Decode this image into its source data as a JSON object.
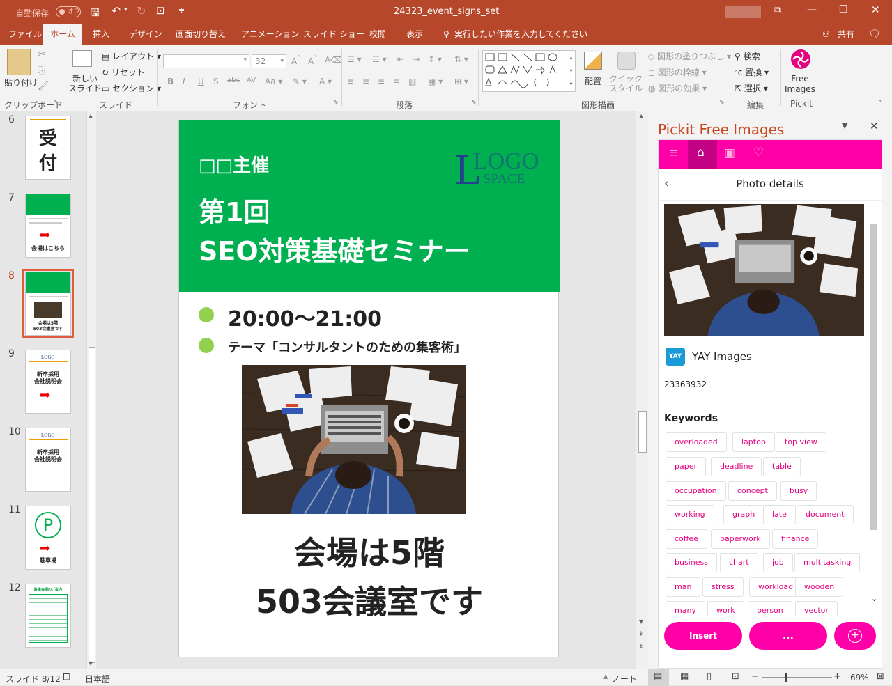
{
  "app": {
    "autosave_label": "自動保存",
    "autosave_state": "オフ",
    "filename": "24323_event_signs_set",
    "accent": "#b7472a"
  },
  "tabs": [
    "ファイル",
    "ホーム",
    "挿入",
    "デザイン",
    "画面切り替え",
    "アニメーション",
    "スライド ショー",
    "校閲",
    "表示"
  ],
  "active_tab": "ホーム",
  "tell_me": "実行したい作業を入力してください",
  "share_label": "共有",
  "ribbon": {
    "clipboard": {
      "paste": "貼り付け",
      "group": "クリップボード"
    },
    "slides": {
      "new_slide": "新しい\nスライド",
      "layout": "レイアウト",
      "reset": "リセット",
      "section": "セクション",
      "group": "スライド"
    },
    "font": {
      "font_size": "32",
      "group": "フォント"
    },
    "paragraph": {
      "group": "段落"
    },
    "drawing": {
      "arrange": "配置",
      "quick_styles": "クイック\nスタイル",
      "fill": "図形の塗りつぶし",
      "outline": "図形の枠線",
      "effects": "図形の効果",
      "group": "図形描画"
    },
    "editing": {
      "find": "検索",
      "replace": "置換",
      "select": "選択",
      "group": "編集"
    },
    "pickit": {
      "button": "Free\nImages",
      "group": "Pickit"
    }
  },
  "thumbnails": [
    {
      "num": "6",
      "text": "受\n付"
    },
    {
      "num": "7",
      "text": "会場はこちら"
    },
    {
      "num": "8",
      "text": "会場は5階\n503会議室です"
    },
    {
      "num": "9",
      "text": "新卒採用\n会社説明会"
    },
    {
      "num": "10",
      "text": "新卒採用\n会社説明会"
    },
    {
      "num": "11",
      "text": "駐車場"
    },
    {
      "num": "12",
      "text": "駐車会場のご案内"
    }
  ],
  "selected_thumbnail": "8",
  "slide": {
    "organizer": "□□主催",
    "logo_top": "LOGO",
    "logo_bottom": "SPACE",
    "title_line1": "第1回",
    "title_line2": "SEO対策基礎セミナー",
    "time": "20:00～21:00",
    "theme": "テーマ「コンサルタントのための集客術」",
    "venue_line1": "会場は5階",
    "venue_line2": "503会議室です",
    "header_color": "#00b050",
    "bullet_color": "#92d050"
  },
  "pickit": {
    "pane_title": "Pickit Free Images",
    "detail_title": "Photo details",
    "source": "YAY Images",
    "source_icon_text": "YAY",
    "image_id": "23363932",
    "keywords_label": "Keywords",
    "keywords": [
      "overloaded",
      "laptop",
      "top view",
      "paper",
      "deadline",
      "table",
      "occupation",
      "concept",
      "busy",
      "working",
      "graph",
      "late",
      "document",
      "coffee",
      "paperwork",
      "finance",
      "business",
      "chart",
      "job",
      "multitasking",
      "man",
      "stress",
      "workload",
      "wooden",
      "many",
      "work",
      "person",
      "vector"
    ],
    "insert_label": "Insert",
    "more_label": "...",
    "accent": "#ff00a8"
  },
  "status": {
    "slide_indicator": "スライド 8/12",
    "language": "日本語",
    "notes_label": "ノート",
    "zoom": "69%"
  }
}
